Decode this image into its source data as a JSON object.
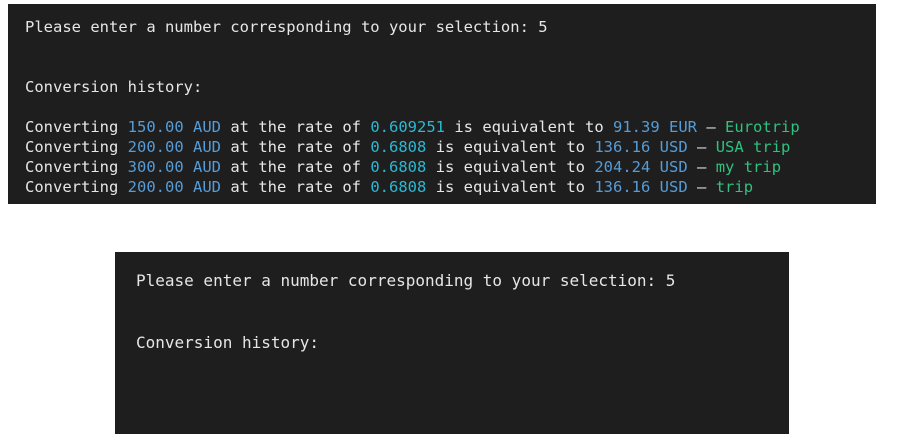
{
  "colors": {
    "terminal_bg": "#1e1e1e",
    "text": "#e6e6e6",
    "amount": "#569cd6",
    "rate": "#2bb8d4",
    "note": "#2ec27e"
  },
  "terminal_top": {
    "prompt_line": "Please enter a number corresponding to your selection: 5",
    "history_header": "Conversion history:",
    "history": [
      {
        "word_converting": "Converting",
        "amount": "150.00 AUD",
        "word_rate": "at the rate of",
        "rate": "0.609251",
        "word_equivalent": "is equivalent to",
        "result": "91.39 EUR",
        "dash": "–",
        "note": "Eurotrip"
      },
      {
        "word_converting": "Converting",
        "amount": "200.00 AUD",
        "word_rate": "at the rate of",
        "rate": "0.6808",
        "word_equivalent": "is equivalent to",
        "result": "136.16 USD",
        "dash": "–",
        "note": "USA trip"
      },
      {
        "word_converting": "Converting",
        "amount": "300.00 AUD",
        "word_rate": "at the rate of",
        "rate": "0.6808",
        "word_equivalent": "is equivalent to",
        "result": "204.24 USD",
        "dash": "–",
        "note": "my trip"
      },
      {
        "word_converting": "Converting",
        "amount": "200.00 AUD",
        "word_rate": "at the rate of",
        "rate": "0.6808",
        "word_equivalent": "is equivalent to",
        "result": "136.16 USD",
        "dash": "–",
        "note": "trip"
      }
    ]
  },
  "terminal_bottom": {
    "prompt_line": "Please enter a number corresponding to your selection: 5",
    "history_header": "Conversion history:"
  }
}
